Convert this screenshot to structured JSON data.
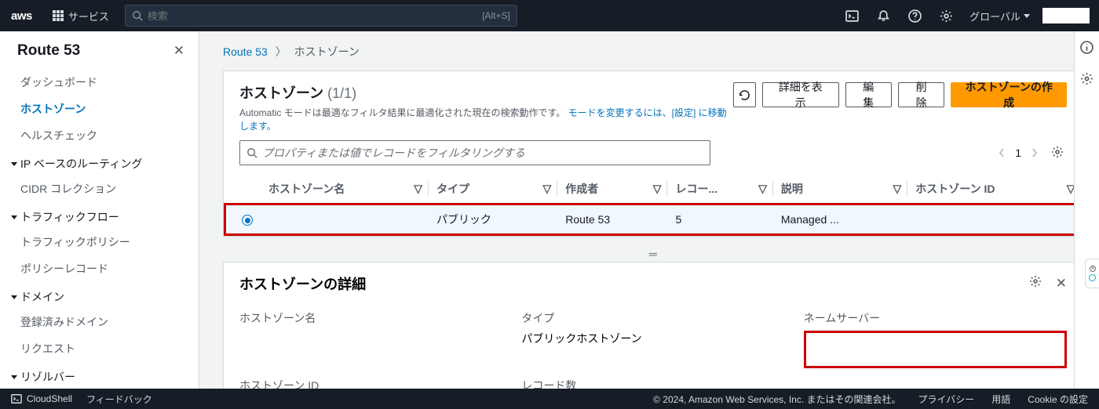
{
  "topnav": {
    "logo": "aws",
    "services": "サービス",
    "search_placeholder": "検索",
    "search_kbd": "[Alt+S]",
    "region": "グローバル"
  },
  "sidebar": {
    "title": "Route 53",
    "items_top": [
      "ダッシュボード",
      "ホストゾーン",
      "ヘルスチェック"
    ],
    "current_index": 1,
    "groups": [
      {
        "label": "IP ベースのルーティング",
        "items": [
          "CIDR コレクション"
        ]
      },
      {
        "label": "トラフィックフロー",
        "items": [
          "トラフィックポリシー",
          "ポリシーレコード"
        ]
      },
      {
        "label": "ドメイン",
        "items": [
          "登録済みドメイン",
          "リクエスト"
        ]
      },
      {
        "label": "リゾルバー",
        "items": []
      }
    ]
  },
  "breadcrumb": {
    "root": "Route 53",
    "current": "ホストゾーン"
  },
  "hostedzones": {
    "title": "ホストゾーン",
    "count": "(1/1)",
    "subtitle_plain": "Automatic モードは最適なフィルタ結果に最適化された現在の検索動作です。",
    "subtitle_link": "モードを変更するには、[設定] に移動します。",
    "actions": {
      "view": "詳細を表示",
      "edit": "編集",
      "delete": "削除",
      "create": "ホストゾーンの作成"
    },
    "filter_placeholder": "プロパティまたは値でレコードをフィルタリングする",
    "page": "1",
    "columns": [
      "ホストゾーン名",
      "タイプ",
      "作成者",
      "レコー...",
      "説明",
      "ホストゾーン ID"
    ],
    "row": {
      "name": "",
      "type": "パブリック",
      "creator": "Route 53",
      "records": "5",
      "desc": "Managed ...",
      "id": ""
    }
  },
  "details": {
    "title": "ホストゾーンの詳細",
    "labels": {
      "name": "ホストゾーン名",
      "id": "ホストゾーン ID",
      "type": "タイプ",
      "type_val": "パブリックホストゾーン",
      "records": "レコード数",
      "ns": "ネームサーバー"
    }
  },
  "footer": {
    "cloudshell": "CloudShell",
    "feedback": "フィードバック",
    "copyright": "© 2024, Amazon Web Services, Inc. またはその関連会社。",
    "privacy": "プライバシー",
    "terms": "用語",
    "cookies": "Cookie の設定"
  }
}
